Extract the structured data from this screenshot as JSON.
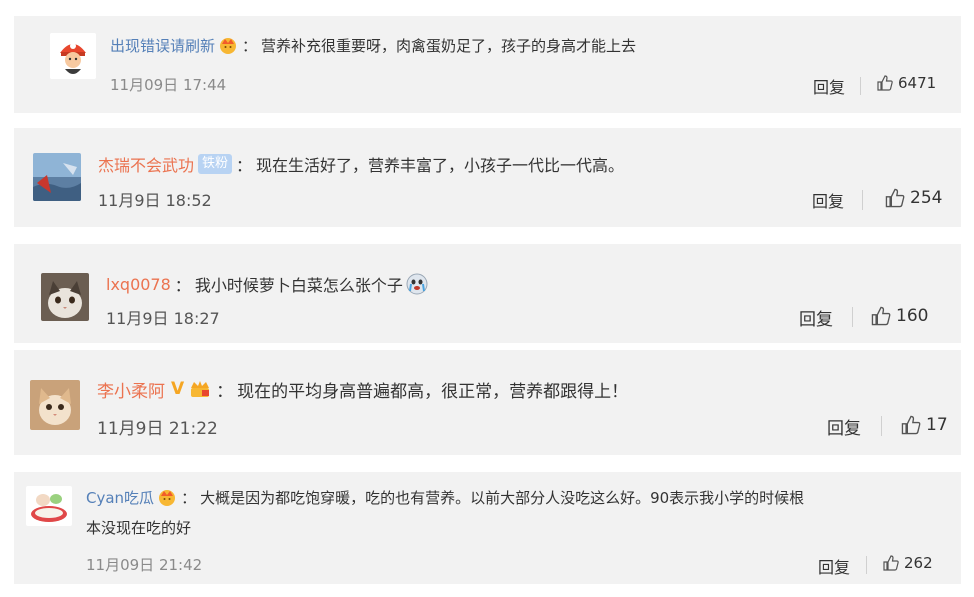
{
  "actions": {
    "reply_label": "回复"
  },
  "comments": [
    {
      "username": "出现错误请刷新",
      "text": "营养补充很重要呀，肉禽蛋奶足了，孩子的身高才能上去",
      "time": "11月09日 17:44",
      "likes": "6471",
      "badge": "crown",
      "name_color": "#5580b8"
    },
    {
      "username": "杰瑞不会武功",
      "text": "现在生活好了，营养丰富了，小孩子一代比一代高。",
      "time": "11月9日 18:52",
      "likes": "254",
      "badge_label": "铁粉",
      "name_color": "#eb7350"
    },
    {
      "username": "lxq0078",
      "text": "我小时候萝卜白菜怎么张个子",
      "time": "11月9日 18:27",
      "likes": "160",
      "name_color": "#eb7350"
    },
    {
      "username": "李小柔阿",
      "text": "现在的平均身高普遍都高，很正常，营养都跟得上！",
      "time": "11月9日 21:22",
      "likes": "17",
      "verified_label": "V",
      "name_color": "#eb7350"
    },
    {
      "username": "Cyan吃瓜",
      "text_line1": "大概是因为都吃饱穿暖，吃的也有营养。以前大部分人没吃这么好。90表示我小学的时候根",
      "text_line2": "本没现在吃的好",
      "time": "11月09日 21:42",
      "likes": "262",
      "badge": "crown",
      "name_color": "#5580b8"
    }
  ]
}
